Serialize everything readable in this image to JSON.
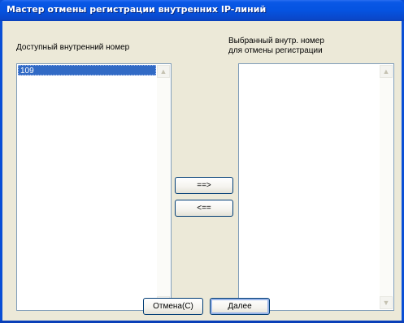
{
  "window": {
    "title": "Мастер отмены регистрации внутренних IP-линий"
  },
  "left_panel": {
    "label": "Доступный внутренний номер",
    "items": [
      "109"
    ]
  },
  "right_panel": {
    "label_line1": "Выбранный внутр. номер",
    "label_line2": "для отмены регистрации",
    "items": []
  },
  "transfer": {
    "add_label": "==>",
    "remove_label": "<=="
  },
  "footer": {
    "cancel_label": "Отмена(С)",
    "next_label": "Далее"
  },
  "icons": {
    "scroll_up": "scroll-up-arrow-icon",
    "scroll_down": "scroll-down-arrow-icon"
  },
  "colors": {
    "titlebar": "#0553e0",
    "selection": "#316ac5",
    "face": "#ece9d8"
  }
}
